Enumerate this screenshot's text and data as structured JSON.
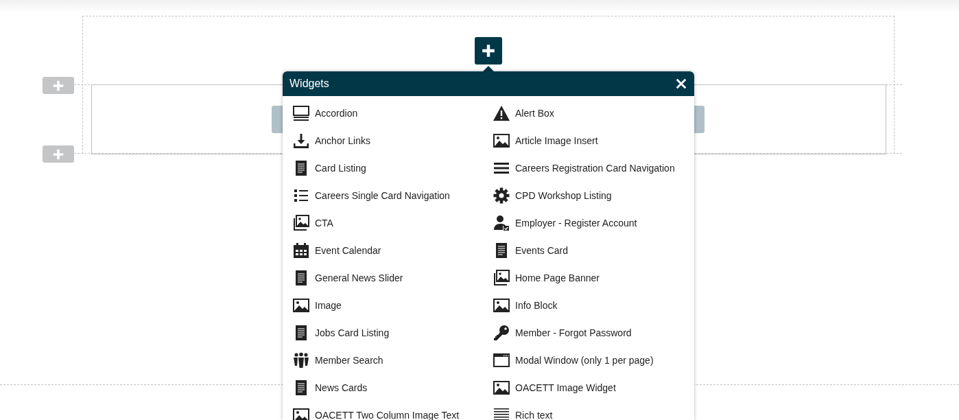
{
  "popup": {
    "title": "Widgets",
    "items": [
      {
        "label": "Accordion",
        "kind": "accordion"
      },
      {
        "label": "Alert Box",
        "kind": "warning"
      },
      {
        "label": "Anchor Links",
        "kind": "download"
      },
      {
        "label": "Article Image Insert",
        "kind": "image"
      },
      {
        "label": "Card Listing",
        "kind": "document"
      },
      {
        "label": "Careers Registration Card Navigation",
        "kind": "bars"
      },
      {
        "label": "Careers Single Card Navigation",
        "kind": "list"
      },
      {
        "label": "CPD Workshop Listing",
        "kind": "gear"
      },
      {
        "label": "CTA",
        "kind": "images"
      },
      {
        "label": "Employer - Register Account",
        "kind": "user-check"
      },
      {
        "label": "Event Calendar",
        "kind": "calendar"
      },
      {
        "label": "Events Card",
        "kind": "document"
      },
      {
        "label": "General News Slider",
        "kind": "document"
      },
      {
        "label": "Home Page Banner",
        "kind": "images"
      },
      {
        "label": "Image",
        "kind": "image"
      },
      {
        "label": "Info Block",
        "kind": "image"
      },
      {
        "label": "Jobs Card Listing",
        "kind": "document"
      },
      {
        "label": "Member - Forgot Password",
        "kind": "key"
      },
      {
        "label": "Member Search",
        "kind": "people"
      },
      {
        "label": "Modal Window (only 1 per page)",
        "kind": "window"
      },
      {
        "label": "News Cards",
        "kind": "document"
      },
      {
        "label": "OACETT Image Widget",
        "kind": "image"
      },
      {
        "label": "OACETT Two Column Image Text",
        "kind": "image"
      },
      {
        "label": "Rich text",
        "kind": "text"
      }
    ]
  }
}
